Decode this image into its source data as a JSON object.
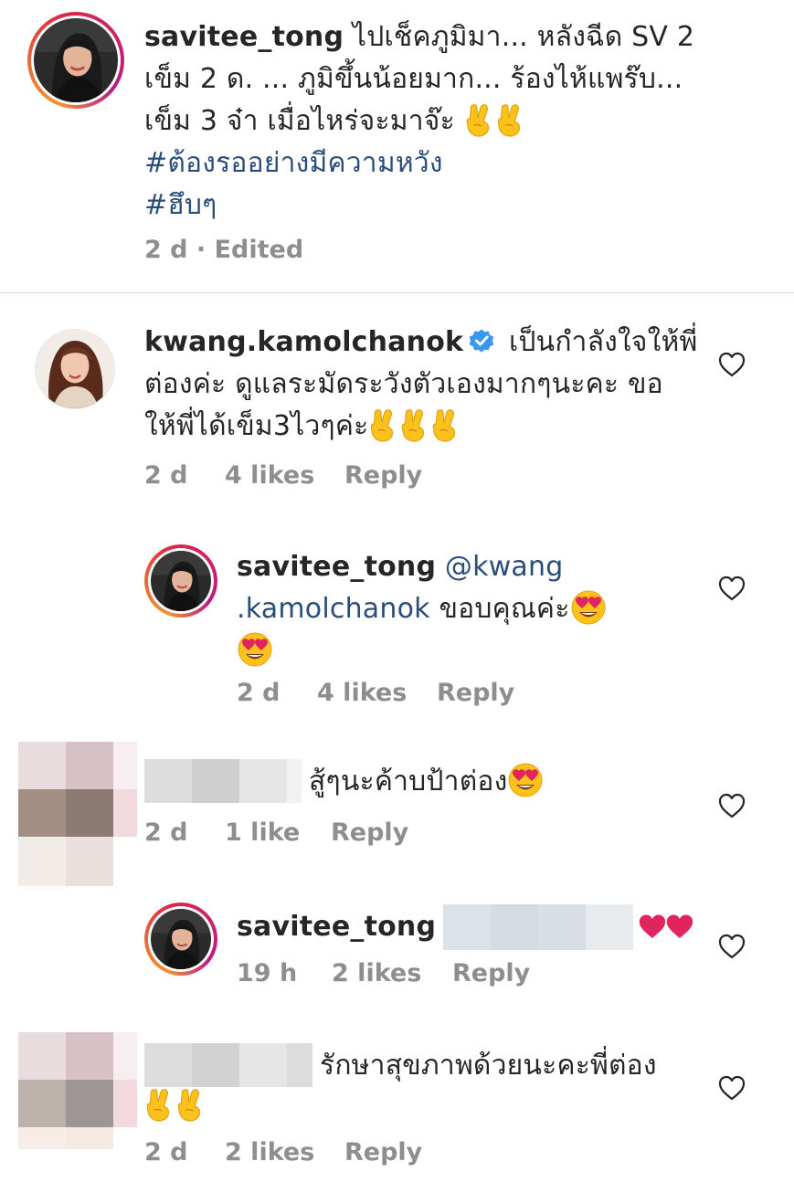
{
  "c1": {
    "username": "savitee_tong",
    "line1": "ไปเช็คภูมิมา... หลังฉีด SV 2",
    "line2": "เข็ม 2 ด. ... ภูมิขึ้นน้อยมาก... ร้องไห้แพร๊บ...",
    "line3": "เข็ม 3 จ๋า เมื่อไหร่จะมาจ๊ะ",
    "tag1": "#ต้องรออย่างมีความหวัง",
    "tag2": "#ฮึบๆ",
    "time": "2 d",
    "sep": " · ",
    "edited": "Edited"
  },
  "c2": {
    "username": "kwang.kamolchanok",
    "line1": "เป็นกำลังใจให้พี่",
    "line2": "ต่องค่ะ ดูแลระมัดระวังตัวเองมากๆนะคะ ขอ",
    "line3": "ให้พี่ได้เข็ม3ไวๆค่ะ",
    "time": "2 d",
    "likes": "4 likes",
    "reply": "Reply"
  },
  "c3": {
    "username": "savitee_tong",
    "mention1": "@kwang",
    "mention2": ".kamolchanok",
    "text": "ขอบคุณค่ะ",
    "time": "2 d",
    "likes": "4 likes",
    "reply": "Reply"
  },
  "c4": {
    "text": "สู้ๆนะค้าบป้าต่อง",
    "time": "2 d",
    "likes": "1 like",
    "reply": "Reply"
  },
  "c5": {
    "username": "savitee_tong",
    "time": "19 h",
    "likes": "2 likes",
    "reply": "Reply"
  },
  "c6": {
    "text": "รักษาสุขภาพด้วยนะคะพี่ต่อง",
    "time": "2 d",
    "likes": "2 likes",
    "reply": "Reply"
  },
  "icons": {
    "like": "heart-outline-icon",
    "verified": "verified-badge-icon",
    "victory": "victory-hand-emoji",
    "heart_eyes": "heart-eyes-emoji",
    "red_heart": "red-heart-emoji"
  },
  "colors": {
    "hashtag": "#2a4d7a",
    "meta": "#8e8e8e",
    "verified": "#3897f0",
    "heart": "#e0245e"
  }
}
